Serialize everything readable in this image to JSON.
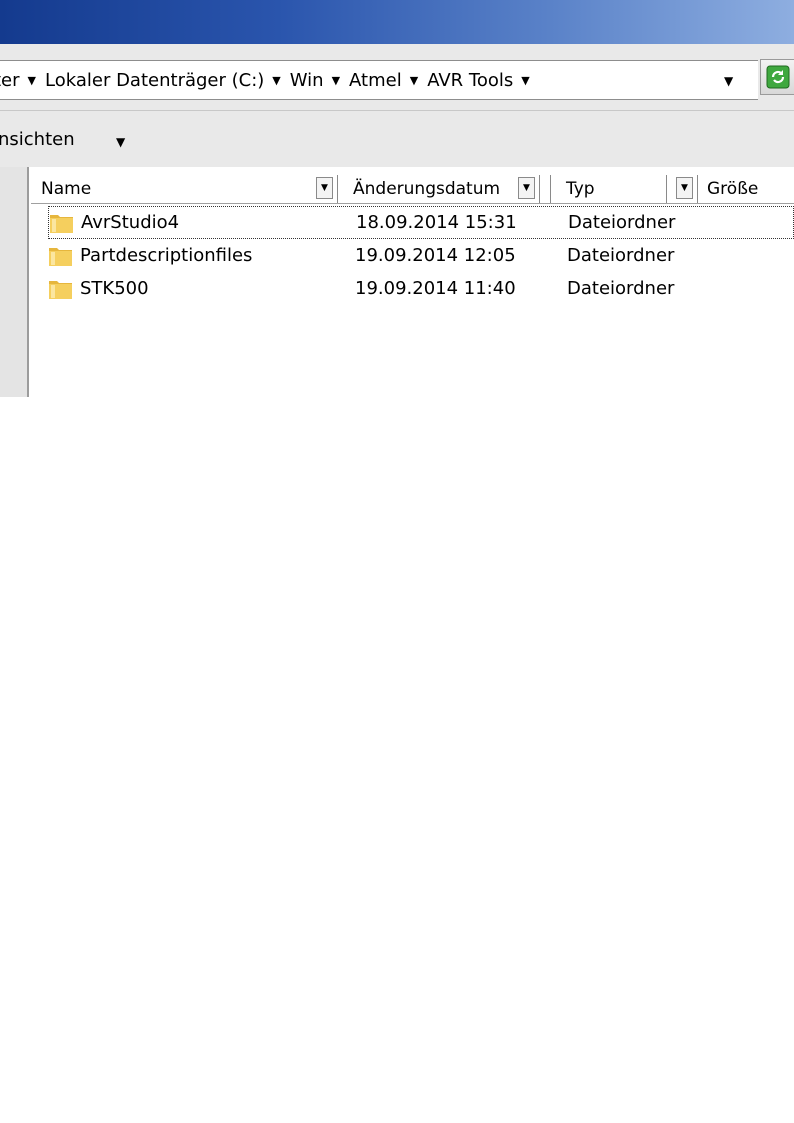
{
  "address": {
    "breadcrumbs": [
      "ter",
      "Lokaler Datenträger (C:)",
      "Win",
      "Atmel",
      "AVR Tools"
    ]
  },
  "toolbar": {
    "views_label": "nsichten"
  },
  "list": {
    "columns": [
      "Name",
      "Änderungsdatum",
      "Typ",
      "Größe"
    ],
    "rows": [
      {
        "name": "AvrStudio4",
        "date": "18.09.2014 15:31",
        "type": "Dateiordner",
        "size": ""
      },
      {
        "name": "Partdescriptionfiles",
        "date": "19.09.2014 12:05",
        "type": "Dateiordner",
        "size": ""
      },
      {
        "name": "STK500",
        "date": "19.09.2014 11:40",
        "type": "Dateiordner",
        "size": ""
      }
    ]
  },
  "icons": {
    "folder": "folder-icon",
    "refresh": "refresh-icon",
    "dropdown": "chevron-down-icon"
  },
  "colors": {
    "titlebar_start": "#143a8e",
    "titlebar_end": "#8eaee0",
    "folder": "#f0c34a"
  }
}
